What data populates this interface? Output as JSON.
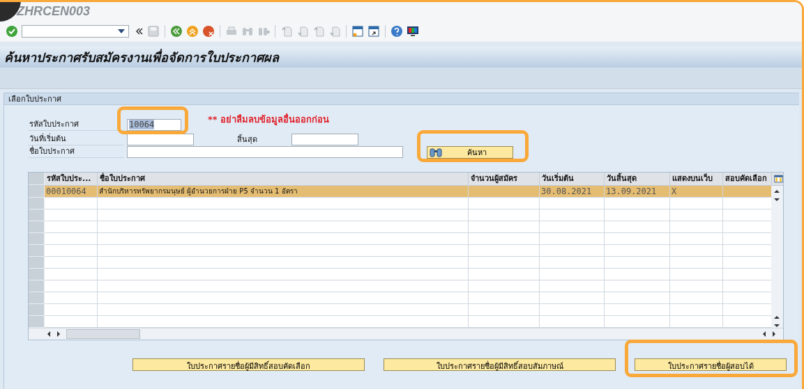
{
  "window": {
    "title": "ZHRCEN003"
  },
  "page_title": "ค้นหาประกาศรับสมัครงานเพื่อจัดการใบประกาศผล",
  "group": {
    "title": "เลือกใบประกาศ",
    "fields": [
      {
        "label": "รหัสใบประกาศ",
        "value": "10064"
      },
      {
        "label": "วันที่เริ่มต้น",
        "second_label": "สิ้นสุด"
      },
      {
        "label": "ชื่อใบประกาศ"
      }
    ],
    "note": "** อย่าลืมลบข้อมูลอื่นออกก่อน",
    "search_button": "ค้นหา"
  },
  "table": {
    "columns": [
      "รหัสใบประ...",
      "ชื่อใบประกาศ",
      "จำนวนผู้สมัคร",
      "วันเริ่มต้น",
      "วันสิ้นสุด",
      "แสดงบนเว็บ",
      "สอบคัดเลือก"
    ],
    "rows": [
      {
        "selected": true,
        "cells": [
          "00010064",
          "สำนักบริหารทรัพยากรมนุษย์ ผู้อำนวยการฝ่าย P5 จำนวน 1 อัตรา",
          null,
          "30.08.2021",
          "13.09.2021",
          "X",
          null
        ]
      }
    ]
  },
  "buttons": [
    "ใบประกาศรายชื่อผู้มีสิทธิ์สอบคัดเลือก",
    "ใบประกาศรายชื่อผู้มีสิทธิ์สอบสัมภาษณ์",
    "ใบประกาศรายชื่อผู้สอบได้"
  ]
}
